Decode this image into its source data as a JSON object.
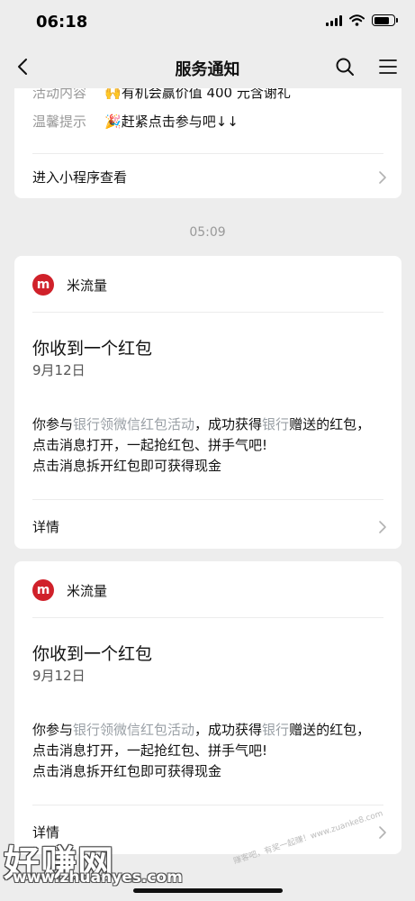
{
  "status_bar": {
    "time": "06:18"
  },
  "nav": {
    "title": "服务通知"
  },
  "top_card": {
    "rows": [
      {
        "label": "活动内容",
        "value": "🙌有机会赢价值 400 元含谢礼"
      },
      {
        "label": "温馨提示",
        "value": "🎉赶紧点击参与吧↓↓"
      }
    ],
    "link": "进入小程序查看"
  },
  "timestamp": "05:09",
  "messages": [
    {
      "brand": "米流量",
      "title": "你收到一个红包",
      "date": "9月12日",
      "body_p1": "你参与",
      "body_hl1": "银行领微信红包活动",
      "body_p2": "，成功获得",
      "body_hl2": "银行",
      "body_p3": "赠送的红包，点击消息打开，一起抢红包、拼手气吧!",
      "body_line2": "点击消息拆开红包即可获得现金",
      "link": "详情"
    },
    {
      "brand": "米流量",
      "title": "你收到一个红包",
      "date": "9月12日",
      "body_p1": "你参与",
      "body_hl1": "银行领微信红包活动",
      "body_p2": "，成功获得",
      "body_hl2": "银行",
      "body_p3": "赠送的红包，点击消息打开，一起抢红包、拼手气吧!",
      "body_line2": "点击消息拆开红包即可获得现金",
      "link": "详情"
    }
  ],
  "watermark": {
    "big": "好赚网",
    "url": "www.zhuanyes.com",
    "small": "赚客吧，有奖一起赚！www.zuanke8.com"
  },
  "colors": {
    "brand_red": "#d0212a",
    "highlight_gray": "#9aa0a6",
    "background": "#ededed"
  }
}
